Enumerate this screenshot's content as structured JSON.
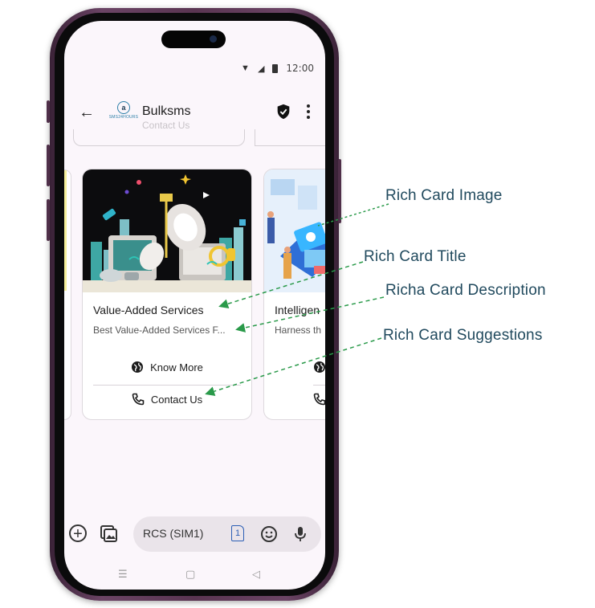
{
  "status_bar": {
    "time": "12:00"
  },
  "header": {
    "title": "Bulksms",
    "logo_text": "SMS24HOURS",
    "ghost_text": "Contact Us"
  },
  "cards": [
    {
      "title": "Value-Added Services",
      "description": "Best Value-Added Services F...",
      "suggestions": [
        {
          "label": "Know More",
          "icon": "globe-icon"
        },
        {
          "label": "Contact Us",
          "icon": "phone-icon"
        }
      ]
    },
    {
      "title": "Intelligen",
      "description": "Harness th",
      "suggestions": [
        {
          "label": "",
          "icon": "globe-icon"
        },
        {
          "label": "",
          "icon": "phone-icon"
        }
      ]
    }
  ],
  "compose": {
    "placeholder": "RCS (SIM1)",
    "sim_number": "1"
  },
  "nav": {
    "recents": "☰",
    "home": "▢",
    "back": "◁"
  },
  "annotations": {
    "image": "Rich Card Image",
    "title": "Rich Card Title",
    "description": "Richa Card Description",
    "suggestions": "Rich Card Suggestions"
  },
  "colors": {
    "frame": "#5a3552",
    "annotation_text": "#214a5e",
    "annotation_arrow": "#2a9a4a",
    "sim_accent": "#2d5fb5"
  }
}
